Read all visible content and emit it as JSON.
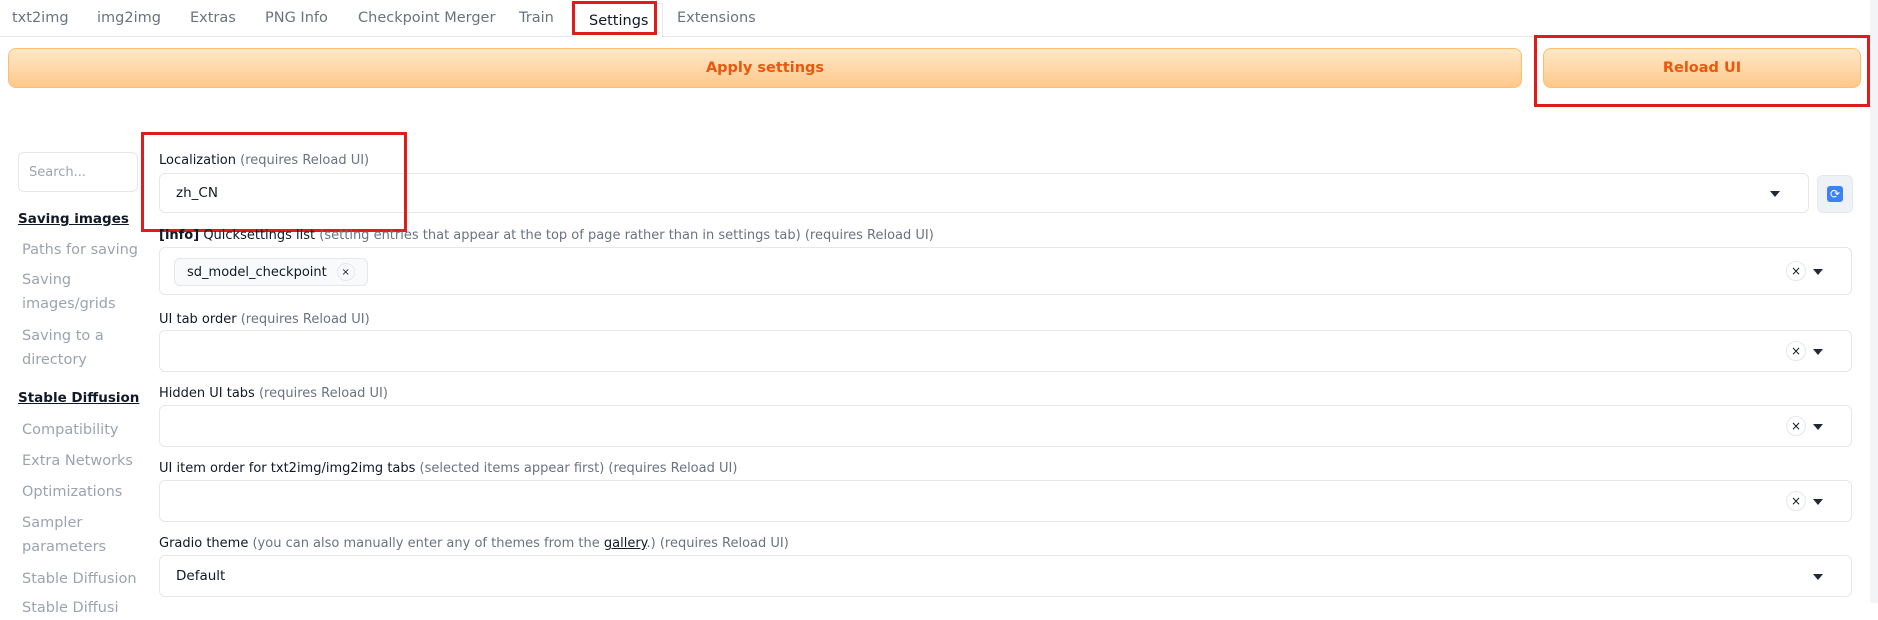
{
  "tabs": [
    {
      "label": "txt2img"
    },
    {
      "label": "img2img"
    },
    {
      "label": "Extras"
    },
    {
      "label": "PNG Info"
    },
    {
      "label": "Checkpoint Merger"
    },
    {
      "label": "Train"
    },
    {
      "label": "Settings"
    },
    {
      "label": "Extensions"
    }
  ],
  "actions": {
    "apply_label": "Apply settings",
    "reload_label": "Reload UI",
    "accent_color": "#ea580c"
  },
  "sidebar": {
    "search_placeholder": "Search...",
    "sections": [
      {
        "title": "Saving images",
        "items": [
          "Paths for saving",
          "Saving images/grids",
          "Saving to a directory"
        ]
      },
      {
        "title": "Stable Diffusion",
        "items": [
          "Compatibility",
          "Extra Networks",
          "Optimizations",
          "Sampler parameters",
          "Stable Diffusion",
          "Stable Diffusi"
        ]
      }
    ]
  },
  "settings": {
    "localization": {
      "label": "Localization",
      "hint": "(requires Reload UI)",
      "value": "zh_CN"
    },
    "quicksettings": {
      "info_tag": "[info]",
      "label": "Quicksettings list",
      "hint": "(setting entries that appear at the top of page rather than in settings tab) (requires Reload UI)",
      "chip": "sd_model_checkpoint"
    },
    "ui_tab_order": {
      "label": "UI tab order",
      "hint": "(requires Reload UI)"
    },
    "hidden_ui_tabs": {
      "label": "Hidden UI tabs",
      "hint": "(requires Reload UI)"
    },
    "ui_item_order": {
      "label": "UI item order for txt2img/img2img tabs",
      "hint": "(selected items appear first) (requires Reload UI)"
    },
    "gradio_theme": {
      "label": "Gradio theme",
      "hint_prefix": "(you can also manually enter any of themes from the",
      "link": "gallery",
      "hint_suffix": ".) (requires Reload UI)",
      "value": "Default"
    }
  },
  "icons": {
    "clear": "×",
    "chip_remove": "×",
    "refresh": "⟳"
  }
}
